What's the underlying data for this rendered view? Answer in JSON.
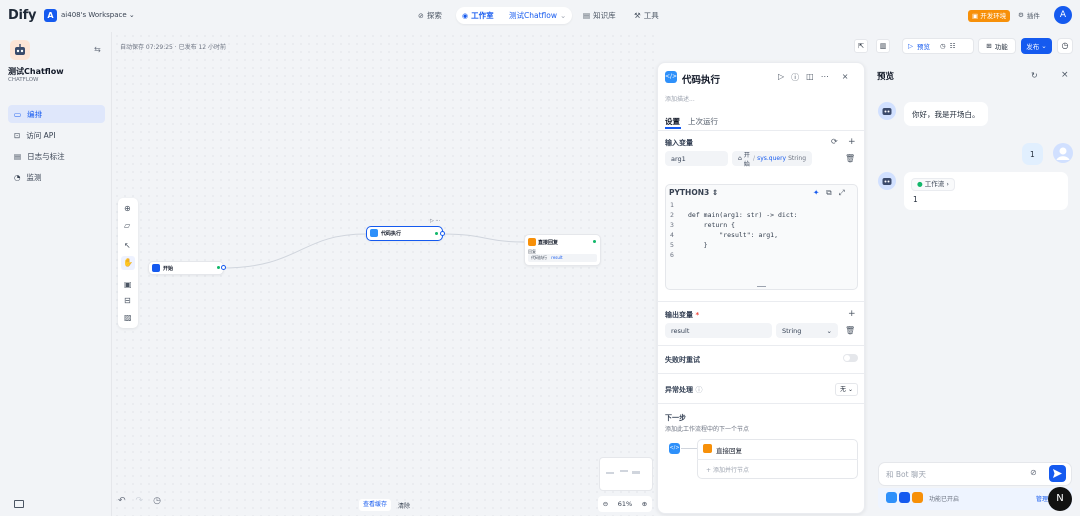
{
  "topbar": {
    "logo": "Dify",
    "workspace_badge": "A",
    "workspace_name": "ai408's Workspace",
    "nav": {
      "explore": "探索",
      "studio": "工作室",
      "app": "测试Chatflow",
      "knowledge": "知识库",
      "tools": "工具"
    },
    "env_badge": "开发环境",
    "plugins": "插件",
    "avatar": "A"
  },
  "sidebar": {
    "app_name": "测试Chatflow",
    "app_type": "CHATFLOW",
    "items": [
      {
        "label": "编排"
      },
      {
        "label": "访问 API"
      },
      {
        "label": "日志与标注"
      },
      {
        "label": "监测"
      }
    ]
  },
  "canvas": {
    "autosave": "自动保存 07:29:25 · 已发布 12 小时前",
    "toolbar": {
      "preview": "预览",
      "features": "功能",
      "publish": "发布"
    },
    "nodes": {
      "start": "开始",
      "code": "代码执行",
      "answer": "直接回复",
      "answer_sub": "回复",
      "answer_var": "代码执行",
      "answer_var_name": "result"
    },
    "zoom": "61%",
    "history": "查看缓存",
    "clear": "清除"
  },
  "panel": {
    "title": "代码执行",
    "desc": "添加描述...",
    "tabs": {
      "settings": "设置",
      "last_run": "上次运行"
    },
    "input_label": "输入变量",
    "input_var": "arg1",
    "input_source_node": "开始",
    "input_source_var": "sys.query",
    "input_source_type": "String",
    "lang": "PYTHON3",
    "code_lines": [
      "",
      "def main(arg1: str) -> dict:",
      "    return {",
      "        \"result\": arg1,",
      "    }",
      ""
    ],
    "line_numbers": [
      "1",
      "2",
      "3",
      "4",
      "5",
      "6"
    ],
    "output_label": "输出变量",
    "required_mark": "*",
    "output_var": "result",
    "output_type": "String",
    "retry_label": "失败时重试",
    "error_label": "异常处理",
    "error_value": "无",
    "next_label": "下一步",
    "next_desc": "添加此工作流程中的下一个节点",
    "next_node": "直接回复",
    "add_next": "添加并行节点"
  },
  "preview": {
    "title": "预览",
    "greeting": "你好，我是开场白。",
    "user_msg": "1",
    "workflow_tag": "工作流",
    "bot_reply": "1",
    "input_placeholder": "和 Bot 聊天",
    "features_enabled": "功能已开启",
    "manage": "管理",
    "fab": "N"
  },
  "colors": {
    "accent": "#155aef",
    "success": "#12b76a",
    "warning": "#f79009"
  }
}
